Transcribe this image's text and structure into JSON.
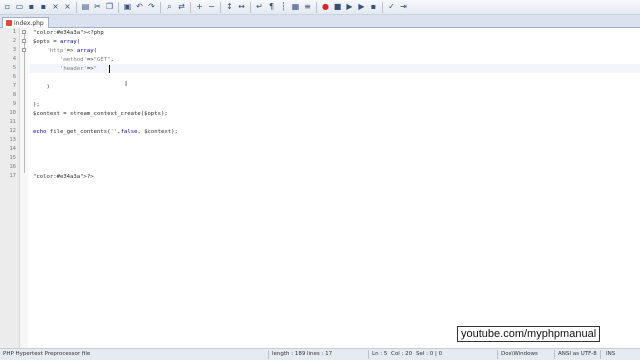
{
  "toolbar": {
    "icons": [
      "new-file-icon",
      "open-icon",
      "save-icon",
      "save-all-icon",
      "close-icon",
      "close-all-icon",
      "print-icon",
      "cut-icon",
      "copy-icon",
      "paste-icon",
      "undo-icon",
      "redo-icon",
      "find-icon",
      "replace-icon",
      "zoom-in-icon",
      "zoom-out-icon",
      "sync-v-icon",
      "sync-h-icon",
      "word-wrap-icon",
      "show-all-icon",
      "indent-guide-icon",
      "doc-map-icon",
      "function-list-icon",
      "record-icon",
      "stop-icon",
      "play-icon",
      "play-multi-icon",
      "save-macro-icon",
      "spellcheck-icon",
      "trim-icon"
    ]
  },
  "tabs": [
    {
      "label": "index.php"
    }
  ],
  "editor": {
    "line_numbers": [
      "1",
      "2",
      "3",
      "4",
      "5",
      "6",
      "7",
      "8",
      "9",
      "10",
      "11",
      "12",
      "13",
      "14",
      "15",
      "16",
      "17"
    ],
    "lines": [
      "<?php",
      "$opts = array(",
      "    'http'=> array(",
      "        'method'=>\"GET\",",
      "        'header'=>\"",
      "",
      "    )",
      "",
      ");",
      "$context = stream_context_create($opts);",
      "",
      "echo file_get_contents('',false, $context);",
      "",
      "",
      "",
      "",
      "?>"
    ]
  },
  "statusbar": {
    "language": "PHP Hypertext Preprocessor file",
    "length": "length : 189",
    "lines": "lines : 17",
    "ln": "Ln : 5",
    "col": "Col : 20",
    "sel": "Sel : 0 | 0",
    "eol": "Dos\\Windows",
    "encoding": "ANSI as UTF-8",
    "mode": "INS"
  },
  "watermark": "youtube.com/myphpmanual",
  "colors": {
    "php_tag": "#e34a3a",
    "keyword": "#0000cc",
    "string": "#808080",
    "current_line": "#f2f6fb"
  }
}
